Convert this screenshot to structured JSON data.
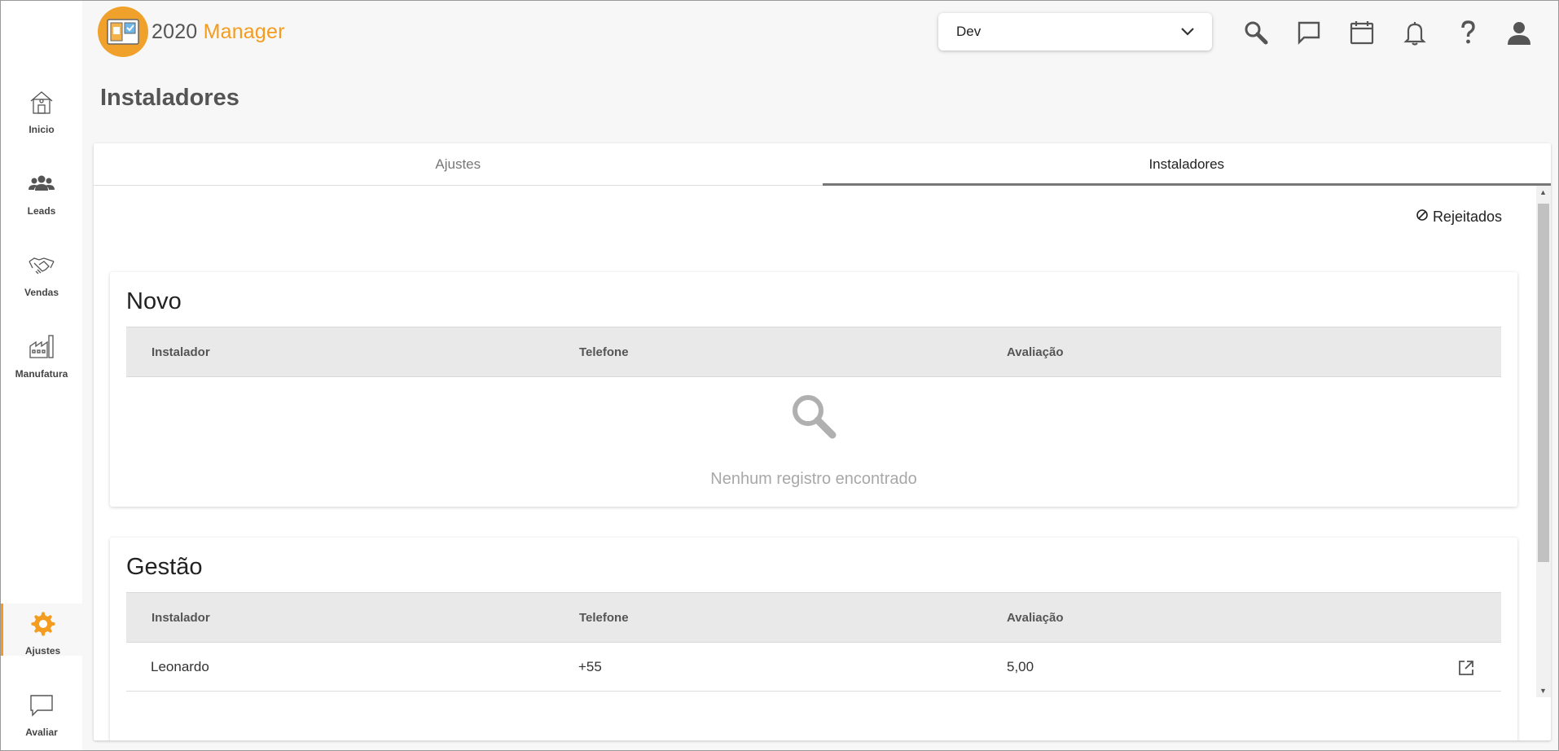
{
  "app": {
    "logo_number": "2020",
    "logo_word": "Manager"
  },
  "header": {
    "environment": "Dev"
  },
  "icons": {
    "search": "search-icon",
    "chat": "chat-icon",
    "calendar": "calendar-icon",
    "bell": "bell-icon",
    "help": "help-icon",
    "user": "user-icon"
  },
  "sidebar": {
    "items": [
      {
        "label": "Inicio",
        "icon": "home-icon"
      },
      {
        "label": "Leads",
        "icon": "people-icon"
      },
      {
        "label": "Vendas",
        "icon": "handshake-icon"
      },
      {
        "label": "Manufatura",
        "icon": "factory-icon"
      },
      {
        "label": "Ajustes",
        "icon": "gear-icon",
        "active": true
      },
      {
        "label": "Avaliar",
        "icon": "feedback-icon"
      }
    ]
  },
  "page": {
    "title": "Instaladores"
  },
  "tabs": [
    {
      "label": "Ajustes",
      "active": false
    },
    {
      "label": "Instaladores",
      "active": true
    }
  ],
  "toolbar": {
    "rejected_label": "Rejeitados"
  },
  "sections": {
    "novo": {
      "title": "Novo",
      "columns": [
        "Instalador",
        "Telefone",
        "Avaliação"
      ],
      "empty_text": "Nenhum registro encontrado"
    },
    "gestao": {
      "title": "Gestão",
      "columns": [
        "Instalador",
        "Telefone",
        "Avaliação"
      ],
      "rows": [
        {
          "instalador": "Leonardo",
          "telefone": "+55",
          "avaliacao": "5,00"
        }
      ]
    }
  },
  "colors": {
    "accent": "#f39c1f",
    "active_tab_underline": "#777777"
  }
}
